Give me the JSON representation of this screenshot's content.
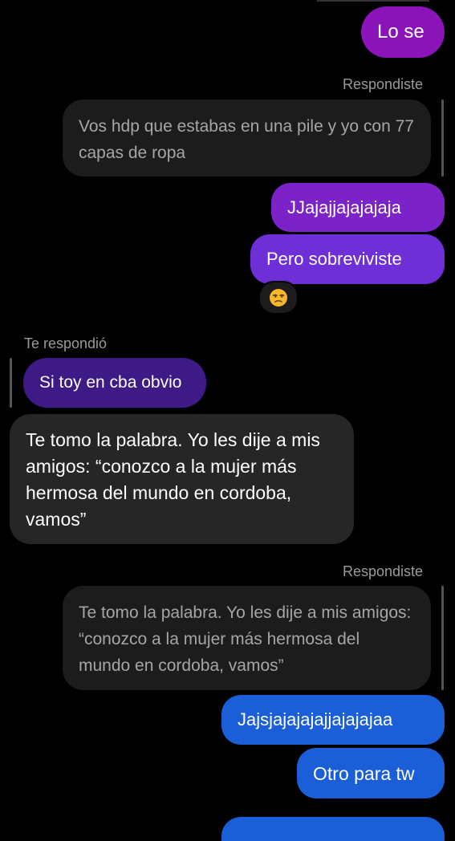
{
  "messages": {
    "m1": {
      "text": "Lo se"
    },
    "reply1": {
      "label": "Respondiste",
      "quoted": "Vos hdp que estabas en una pile y yo con 77 capas de ropa"
    },
    "m2": {
      "text": "JJajajjajajajaja"
    },
    "m3": {
      "text": "Pero sobreviviste"
    },
    "reaction1": {
      "icon": "unamused-face-icon"
    },
    "reply2": {
      "label": "Te respondió",
      "text": "Si toy en cba obvio"
    },
    "m4": {
      "text": "Te tomo la palabra. Yo les dije a mis amigos: “conozco a la mujer más hermosa del mundo en cordoba, vamos”"
    },
    "reply3": {
      "label": "Respondiste",
      "quoted": "Te tomo la palabra. Yo les dije a mis amigos: “conozco a la mujer más hermosa del mundo en cordoba, vamos”"
    },
    "m5": {
      "text": "Jajsjajajajajjajajajaa"
    },
    "m6": {
      "text": "Otro para tw"
    }
  },
  "colors": {
    "background": "#000000",
    "outgoing_purple": "#8a14b8",
    "outgoing_violet": "#6e2fd6",
    "outgoing_blue": "#1a5fd8",
    "incoming": "#262626",
    "quoted_reply": "#1c1c1c"
  }
}
